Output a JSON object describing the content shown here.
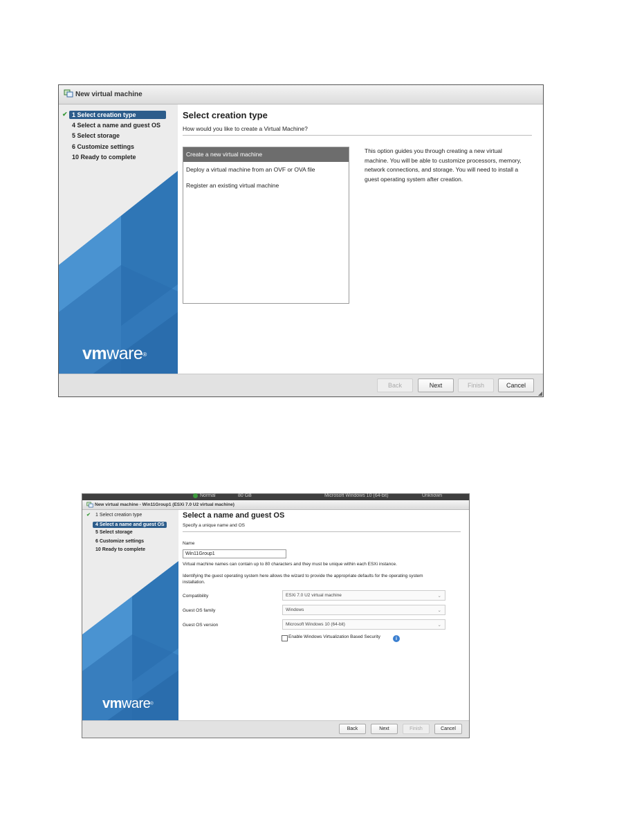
{
  "top_dialog": {
    "title": "New virtual machine",
    "steps": [
      {
        "label": "1 Select creation type",
        "done": true,
        "active": true
      },
      {
        "label": "4 Select a name and guest OS",
        "done": false,
        "active": false
      },
      {
        "label": "5 Select storage",
        "done": false,
        "active": false
      },
      {
        "label": "6 Customize settings",
        "done": false,
        "active": false
      },
      {
        "label": "10 Ready to complete",
        "done": false,
        "active": false
      }
    ],
    "logo": {
      "bold": "vm",
      "rest": "ware",
      "mark": "®"
    },
    "heading": "Select creation type",
    "subheading": "How would you like to create a Virtual Machine?",
    "options": [
      "Create a new virtual machine",
      "Deploy a virtual machine from an OVF or OVA file",
      "Register an existing virtual machine"
    ],
    "selected_option": 0,
    "description_lines": [
      "This option guides you through creating a new virtual",
      "machine. You will be able to customize processors, memory,",
      "network connections, and storage. You will need to install a",
      "guest operating system after creation."
    ],
    "buttons": {
      "back": "Back",
      "next": "Next",
      "finish": "Finish",
      "cancel": "Cancel"
    }
  },
  "bottom_dialog": {
    "strip": {
      "status": "Normal",
      "size": "80 GB",
      "os": "Microsoft Windows 10 (64-bit)",
      "state": "Unknown"
    },
    "title": "New virtual machine - Win11Group1 (ESXi 7.0 U2 virtual machine)",
    "steps": [
      {
        "label": "1 Select creation type",
        "done": true,
        "active": false
      },
      {
        "label": "4 Select a name and guest OS",
        "done": false,
        "active": true
      },
      {
        "label": "5 Select storage",
        "done": false,
        "active": false
      },
      {
        "label": "6 Customize settings",
        "done": false,
        "active": false
      },
      {
        "label": "10 Ready to complete",
        "done": false,
        "active": false
      }
    ],
    "logo": {
      "bold": "vm",
      "rest": "ware",
      "mark": "®"
    },
    "heading": "Select a name and guest OS",
    "subheading": "Specify a unique name and OS",
    "name_label": "Name",
    "name_value": "Win11Group1",
    "name_note": "Virtual machine names can contain up to 80 characters and they must be unique within each ESXi instance.",
    "os_note_lines": [
      "Identifying the guest operating system here allows the wizard to provide the appropriate defaults for the operating system",
      "installation."
    ],
    "compatibility_label": "Compatibility",
    "compatibility_value": "ESXi 7.0 U2 virtual machine",
    "family_label": "Guest OS family",
    "family_value": "Windows",
    "version_label": "Guest OS version",
    "version_value": "Microsoft Windows 10 (64-bit)",
    "vbs_label": "Enable Windows Virtualization Based Security",
    "vbs_checked": false,
    "buttons": {
      "back": "Back",
      "next": "Next",
      "finish": "Finish",
      "cancel": "Cancel"
    }
  },
  "colors": {
    "accent": "#2d5d8b",
    "selected_option": "#6d6d6d",
    "check": "#3a9a3a",
    "info": "#3b7fd0"
  }
}
